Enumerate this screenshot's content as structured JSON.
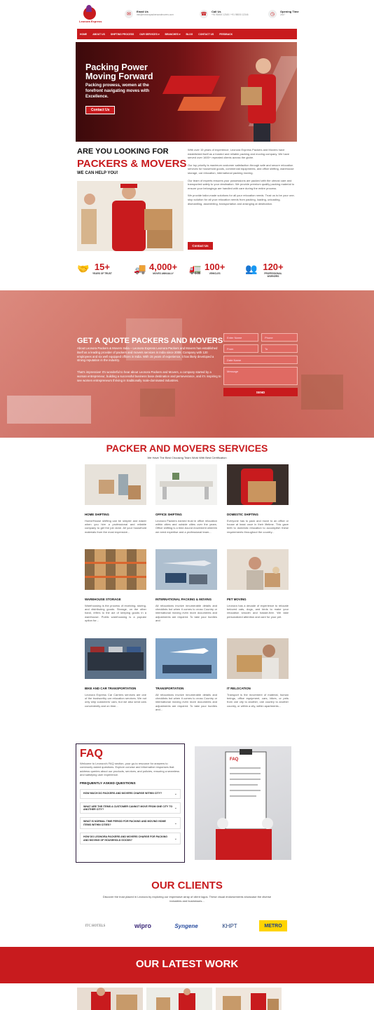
{
  "header": {
    "logo_text": "Leonora Express",
    "email_label": "Email Us",
    "email_value": "info@leonorapackersandmovers.com",
    "call_label": "Call Us",
    "call_value": "+91 98000 12345 / +91 98000 12346",
    "hours_label": "Opening Time",
    "hours_value": "24x7"
  },
  "nav": [
    "HOME",
    "ABOUT US",
    "SHIFTING PROCESS",
    "OUR SERVICES",
    "BRANCHES",
    "BLOG",
    "CONTACT US",
    "FEEDBACK"
  ],
  "hero": {
    "title": "Packing Power Moving Forward",
    "subtitle": "Packing prowess, women at the forefront navigating moves with Excellence.",
    "button": "Contact Us"
  },
  "about": {
    "heading1": "ARE YOU LOOKING FOR",
    "heading2": "PACKERS & MOVERS",
    "heading3": "WE CAN HELP YOU!",
    "paragraphs": [
      "With over 15 years of experience, Leonora Express Packers and Movers have established itself as a trusted and reliable packing and moving company. We have served over 1600+ repeated clients across the globe.",
      "Our top priority is maximum customer satisfaction through safe and secure relocation services for household goods, commercial equipments, and office shifting, warehouse storage, car relocation, international packing moving.",
      "Our team of experts ensures your possessions are packed with the utmost care and transported safely to your destination. We provide premium quality packing material to ensure your belongings are handled with care during the entire process.",
      "We provide tailor-made solutions for all your relocation needs. Trust us to be your one-stop solution for all your relocation needs from packing, loading, unloading, dismantling, assembling, transportation and arranging at destination."
    ],
    "button": "Contact Us"
  },
  "stats": [
    {
      "num": "15+",
      "label": "YEARS OF TRUST",
      "icon": "handshake-icon"
    },
    {
      "num": "4,000+",
      "label": "MOVES ANNUALLY",
      "icon": "truck-icon"
    },
    {
      "num": "100+",
      "label": "VEHICLES",
      "icon": "vehicle-icon"
    },
    {
      "num": "120+",
      "label": "PROFESSIONAL WORKERS",
      "icon": "workers-icon"
    }
  ],
  "quote": {
    "title": "GET A QUOTE PACKERS AND MOVERS",
    "p1": "About Leonora Packers & Movers India – Leonora Express Leonora Packers and Movers has established itself as a leading provider of packers and movers services in India since 2008. Company with 120 employees and six well equipped offices in India. With 15 years of experience, it has likely developed a strong reputation in the industry.",
    "p2": "That's impressive! It's wonderful to hear about Leonora Packers and Movers, a company started by a woman entrepreneur, building a successful business base destination and perseverance, and it's inspiring to see women entrepreneurs thriving in traditionally male-dominated industries.",
    "fields": {
      "name": "Enter Name",
      "phone": "Phone",
      "from": "From",
      "to": "To",
      "date": "Date Name",
      "message": "Message"
    },
    "send": "SEND"
  },
  "services": {
    "title": "PACKER AND MOVERS SERVICES",
    "subtitle": "We Have The Best Choosing Team Work With Best Certification",
    "items": [
      {
        "title": "HOME SHIFTING",
        "desc": "Home/House shifting can be simpler and easier when you hire a professional and reliable company to get the job done. All your household materials from the most expensive..."
      },
      {
        "title": "OFFICE SHIFTING",
        "desc": "Leonora Packers earned trust in office relocation within cities and outside cities over the years. Office shifting is a time-bound movement wherein we need expertise and a professional team..."
      },
      {
        "title": "DOMESTIC SHIFTING",
        "desc": "Everyone has to pack and move to an office or house at least once in their lifetime. This gave birth to domestic relocation to accomplish these requirements throughout the country..."
      },
      {
        "title": "WAREHOUSE STORAGE",
        "desc": "Warehousing is the process of receiving, storing, and distributing goods. Storage, on the other hand, refers to the act of keeping goods in a warehouse. Public warehousing is a popular option for..."
      },
      {
        "title": "INTERNATIONAL PACKING & MOVING",
        "desc": "All relocations involve innumerable details and checklists but when it comes to cross Country or international moving even more documents and adjustments are required. To take your hurdles and"
      },
      {
        "title": "PET MOVING",
        "desc": "Leonora has a decade of experience to relocate beloved cats, dogs, and birds to make your relocation smooth and hassle-free. We take personalized attention and care for your pet."
      },
      {
        "title": "BIKE AND CAR TRANSPORTATION",
        "desc": "Leonora Express Car Carriers services are one of the trustworthy car relocation services. We not only ship customers' cars, but we also send cars conveniently and on time..."
      },
      {
        "title": "TRANSPORTATION",
        "desc": "All relocations involve innumerable details and checklists but when it comes to cross Country or international moving even more documents and adjustments are required. To take your hurdles and..."
      },
      {
        "title": "IT RELOCATION",
        "desc": "Transport is the movement of material, human beings, office equipment, cars, bikes, or pets from one city to another, one country to another country, or within a city, within apartments..."
      }
    ]
  },
  "faq": {
    "title": "FAQ",
    "intro": "Welcome to Leonora's FAQ section, your go-to resource for answers to commonly asked questions. Explore concise and informative responses that address queries about our products, services, and policies, ensuring a seamless and satisfying user experience.",
    "subtitle": "FREQUENTLY ASKED QUESTIONS",
    "questions": [
      "HOW MUCH DO PACKERS AND MOVERS CHARGE WITHIN CITY?",
      "WHAT ARE THE ITEMS A CUSTOMER CANNOT MOVE FROM ONE CITY TO ANOTHER CITY?",
      "WHAT IS NORMAL TIME PERIOD FOR PACKING AND MOVING HOME ITEMS WITHIN CITIES?",
      "HOW DO LEONORA PACKERS AND MOVERS CHARGE FOR PACKING AND MOVING OF HOUSEHOLD GOODS?"
    ],
    "clipboard_title": "FAQ"
  },
  "clients": {
    "title": "OUR CLIENTS",
    "subtitle": "Discover the trust placed in Leonora by exploring our impressive array of client logos. These visual endorsements showcase the diverse industries and businesses...",
    "logos": [
      "ITC HOTELS",
      "wipro",
      "Syngene",
      "KHPT",
      "METRO"
    ]
  },
  "latest_work": {
    "title": "OUR LATEST WORK"
  },
  "colors": {
    "brand": "#c81b1e"
  }
}
